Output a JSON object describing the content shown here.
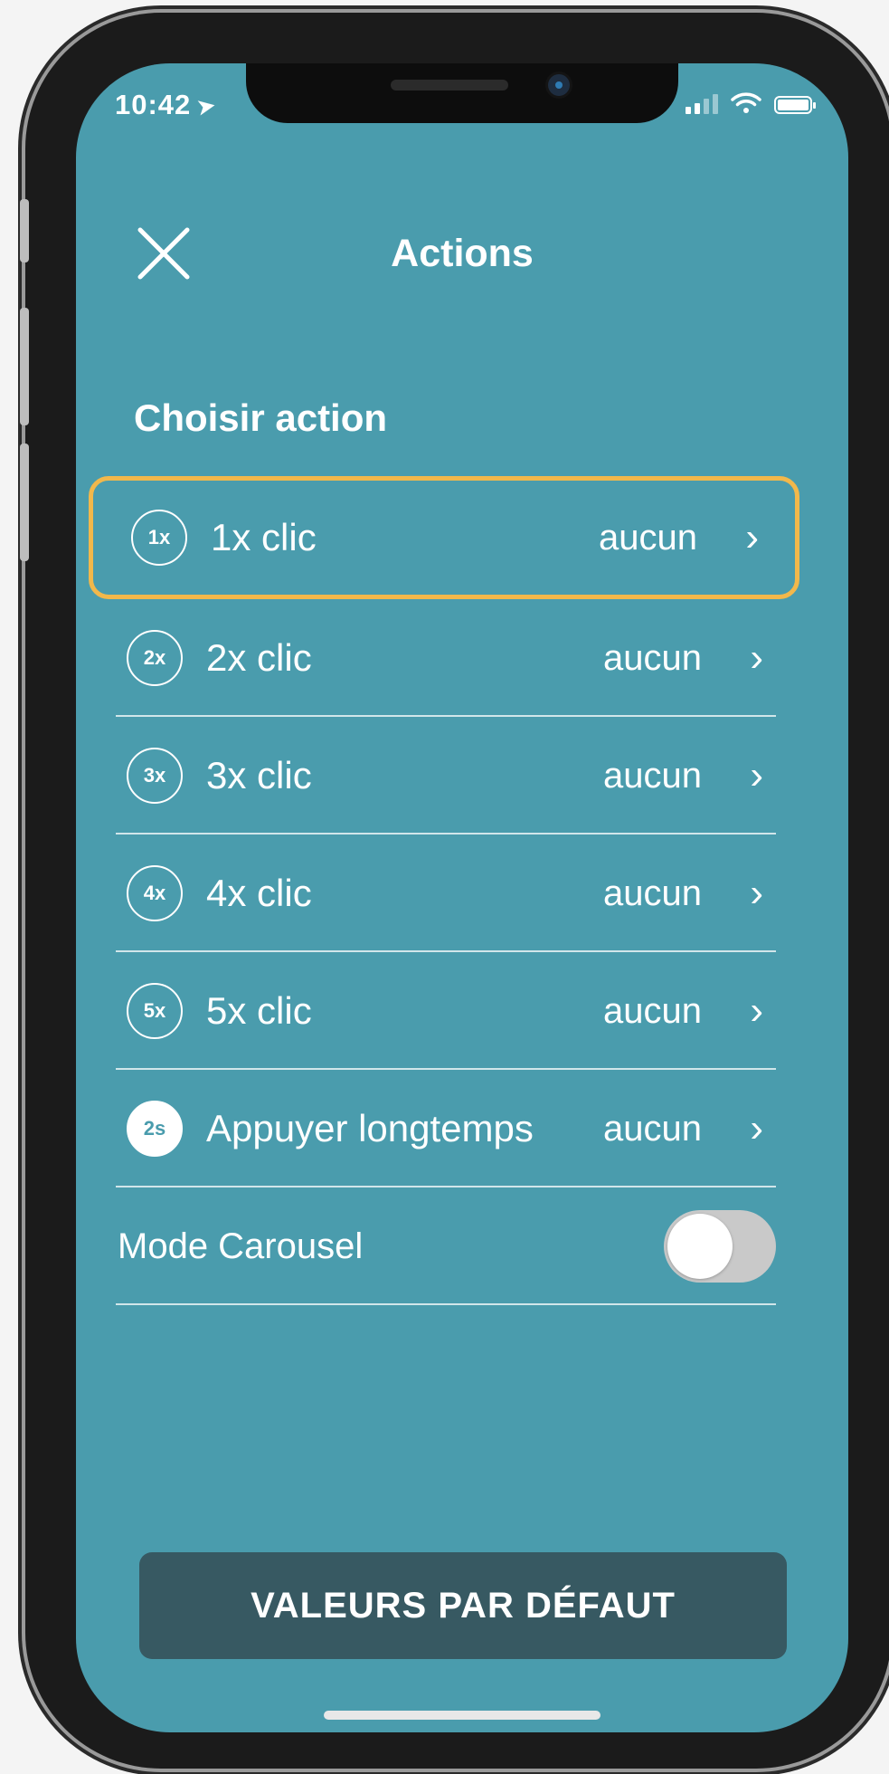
{
  "status_bar": {
    "time": "10:42"
  },
  "header": {
    "title": "Actions"
  },
  "section": {
    "title": "Choisir action"
  },
  "actions": [
    {
      "badge": "1x",
      "label": "1x clic",
      "value": "aucun",
      "selected": true
    },
    {
      "badge": "2x",
      "label": "2x clic",
      "value": "aucun"
    },
    {
      "badge": "3x",
      "label": "3x clic",
      "value": "aucun"
    },
    {
      "badge": "4x",
      "label": "4x clic",
      "value": "aucun"
    },
    {
      "badge": "5x",
      "label": "5x clic",
      "value": "aucun"
    },
    {
      "badge": "2s",
      "label": "Appuyer longtemps",
      "value": "aucun"
    }
  ],
  "carousel": {
    "label": "Mode Carousel",
    "enabled": false
  },
  "footer": {
    "default_button": "VALEURS PAR DÉFAUT"
  },
  "colors": {
    "background": "#4a9cad",
    "highlight": "#f2b84b",
    "button": "#375962"
  }
}
